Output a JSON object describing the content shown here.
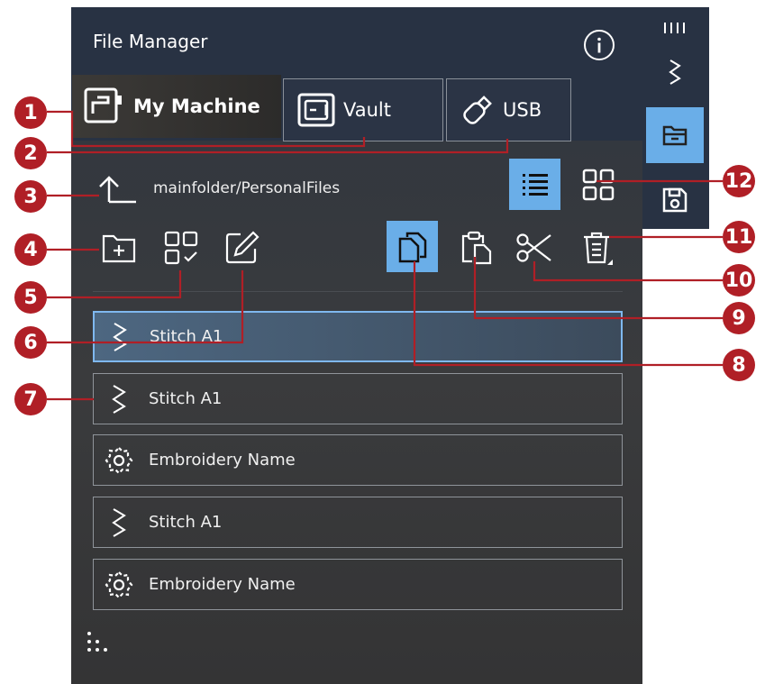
{
  "header": {
    "title": "File Manager"
  },
  "tabs": [
    {
      "label": "My Machine",
      "icon": "sewing-machine-icon",
      "active": true
    },
    {
      "label": "Vault",
      "icon": "vault-icon",
      "active": false
    },
    {
      "label": "USB",
      "icon": "usb-stick-icon",
      "active": false
    }
  ],
  "sidebar": {
    "items": [
      "menu-icon",
      "stitch-icon",
      "folder-icon",
      "save-icon"
    ],
    "active": "folder-icon"
  },
  "path": {
    "label": "mainfolder/PersonalFiles"
  },
  "view": {
    "active": "list"
  },
  "files": [
    {
      "name": "Stitch A1",
      "type": "stitch",
      "selected": true
    },
    {
      "name": "Stitch A1",
      "type": "stitch",
      "selected": false
    },
    {
      "name": "Embroidery Name",
      "type": "embroidery",
      "selected": false
    },
    {
      "name": "Stitch A1",
      "type": "stitch",
      "selected": false
    },
    {
      "name": "Embroidery Name",
      "type": "embroidery",
      "selected": false
    }
  ],
  "callouts": [
    "1",
    "2",
    "3",
    "4",
    "5",
    "6",
    "7",
    "8",
    "9",
    "10",
    "11",
    "12"
  ],
  "colors": {
    "callout": "#b01f26",
    "accent": "#6aaee8",
    "panel": "#283243"
  }
}
